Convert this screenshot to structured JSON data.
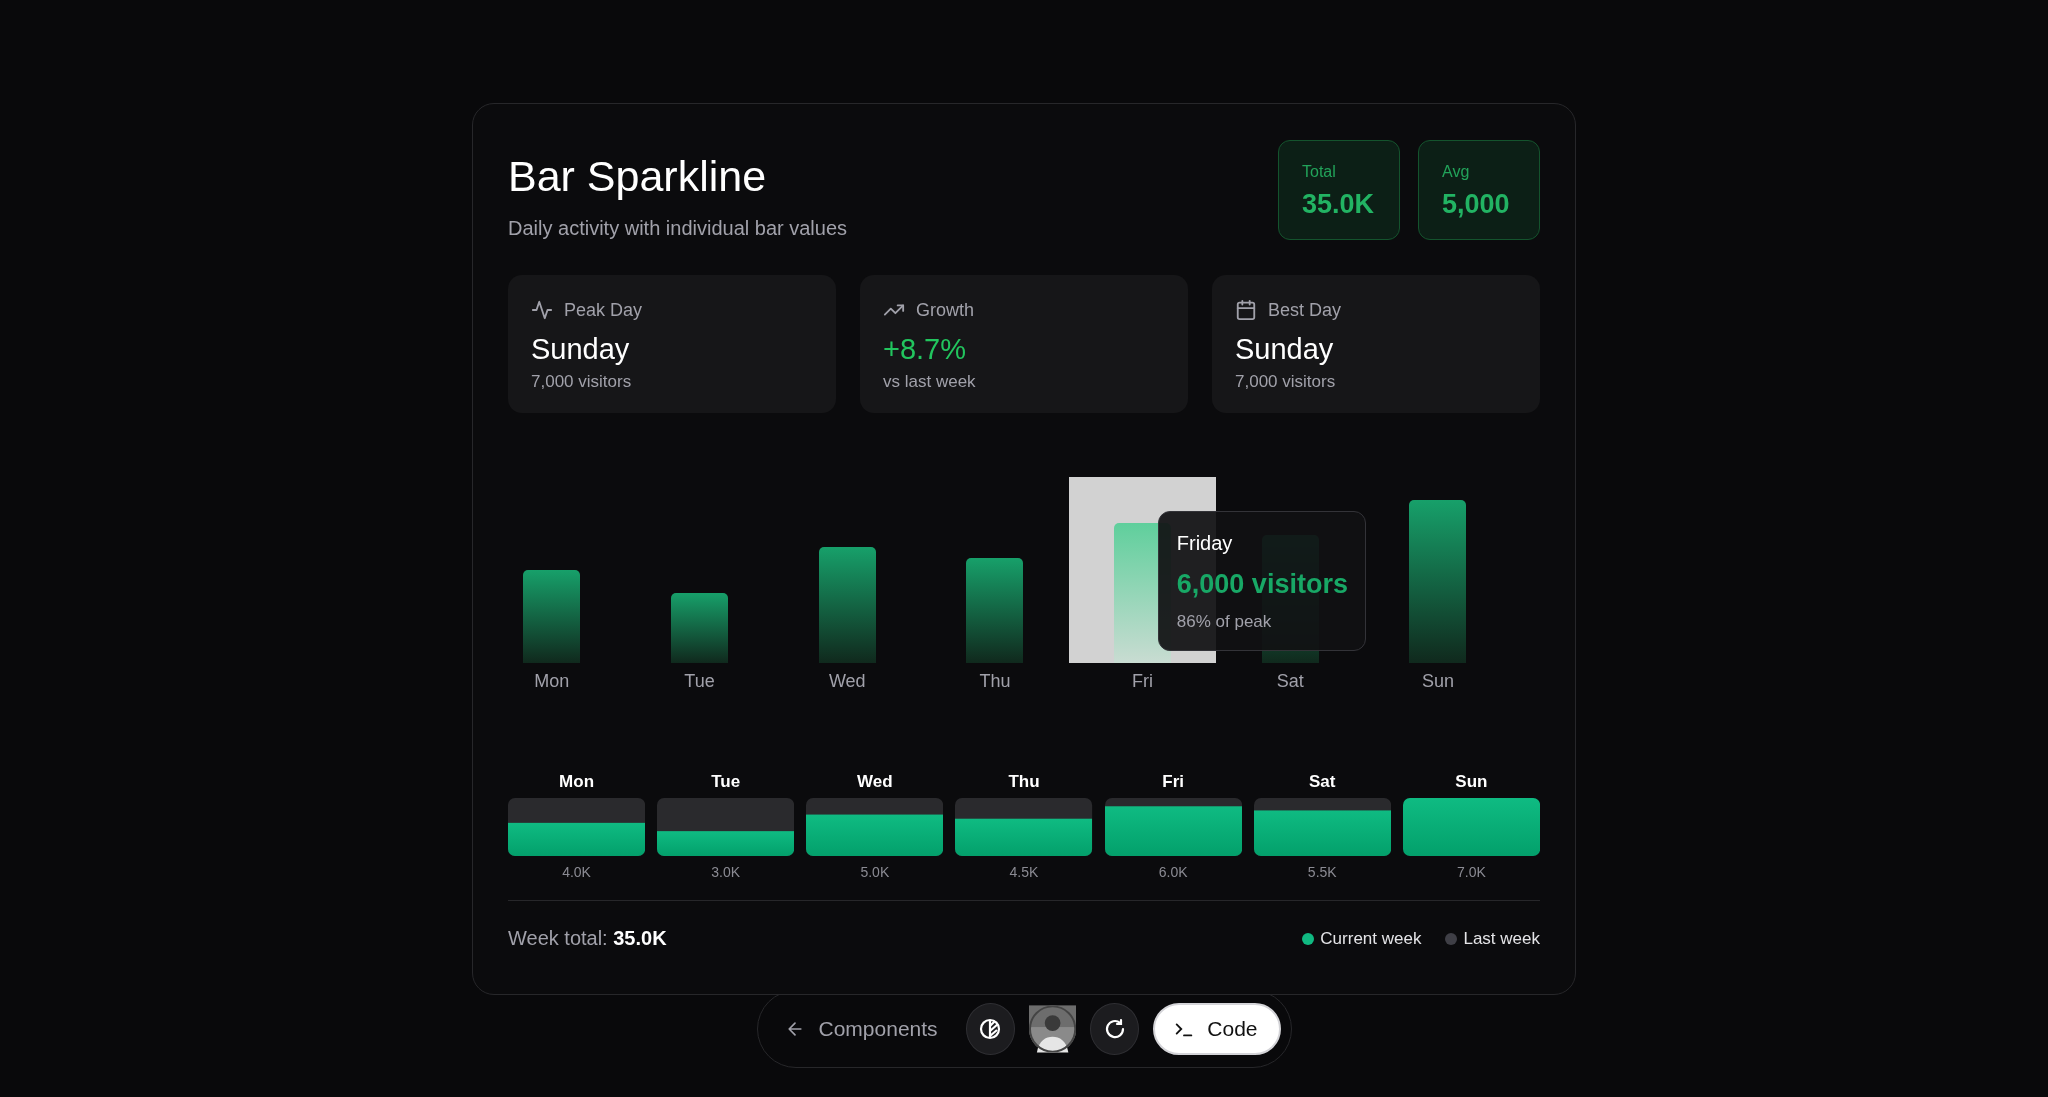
{
  "header": {
    "title": "Bar Sparkline",
    "subtitle": "Daily activity with individual bar values"
  },
  "totals": [
    {
      "label": "Total",
      "value": "35.0K"
    },
    {
      "label": "Avg",
      "value": "5,000"
    }
  ],
  "metrics": [
    {
      "kind": "pulse",
      "label": "Peak Day",
      "value": "Sunday",
      "note": "7,000 visitors",
      "positive": false
    },
    {
      "kind": "trend",
      "label": "Growth",
      "value": "+8.7%",
      "note": "vs last week",
      "positive": true
    },
    {
      "kind": "calendar",
      "label": "Best Day",
      "value": "Sunday",
      "note": "7,000 visitors",
      "positive": false
    }
  ],
  "sparkline": {
    "bars": [
      {
        "label": "Mon",
        "selected": false
      },
      {
        "label": "Tue",
        "selected": false
      },
      {
        "label": "Wed",
        "selected": false
      },
      {
        "label": "Thu",
        "selected": false
      },
      {
        "label": "Fri",
        "selected": true
      },
      {
        "label": "Sat",
        "selected": false
      },
      {
        "label": "Sun",
        "selected": false
      }
    ],
    "tooltip": {
      "title": "Friday",
      "value": "6,000 visitors",
      "note": "86% of peak"
    }
  },
  "comparison": {
    "chart_data": {
      "type": "bar",
      "categories": [
        "Mon",
        "Tue",
        "Wed",
        "Thu",
        "Fri",
        "Sat",
        "Sun"
      ],
      "values": [
        4000,
        3000,
        5000,
        4500,
        6000,
        5500,
        7000
      ],
      "ylim": [
        0,
        7000
      ],
      "value_labels": [
        "4.0K",
        "3.0K",
        "5.0K",
        "4.5K",
        "6.0K",
        "5.5K",
        "7.0K"
      ]
    }
  },
  "footer": {
    "label": "Week total:",
    "value": "35.0K",
    "legend": [
      {
        "label": "Current week",
        "color": "#10b981"
      },
      {
        "label": "Last week",
        "color": "#3f3f46"
      }
    ]
  },
  "toolbar": {
    "back": "Components",
    "code": "Code"
  }
}
